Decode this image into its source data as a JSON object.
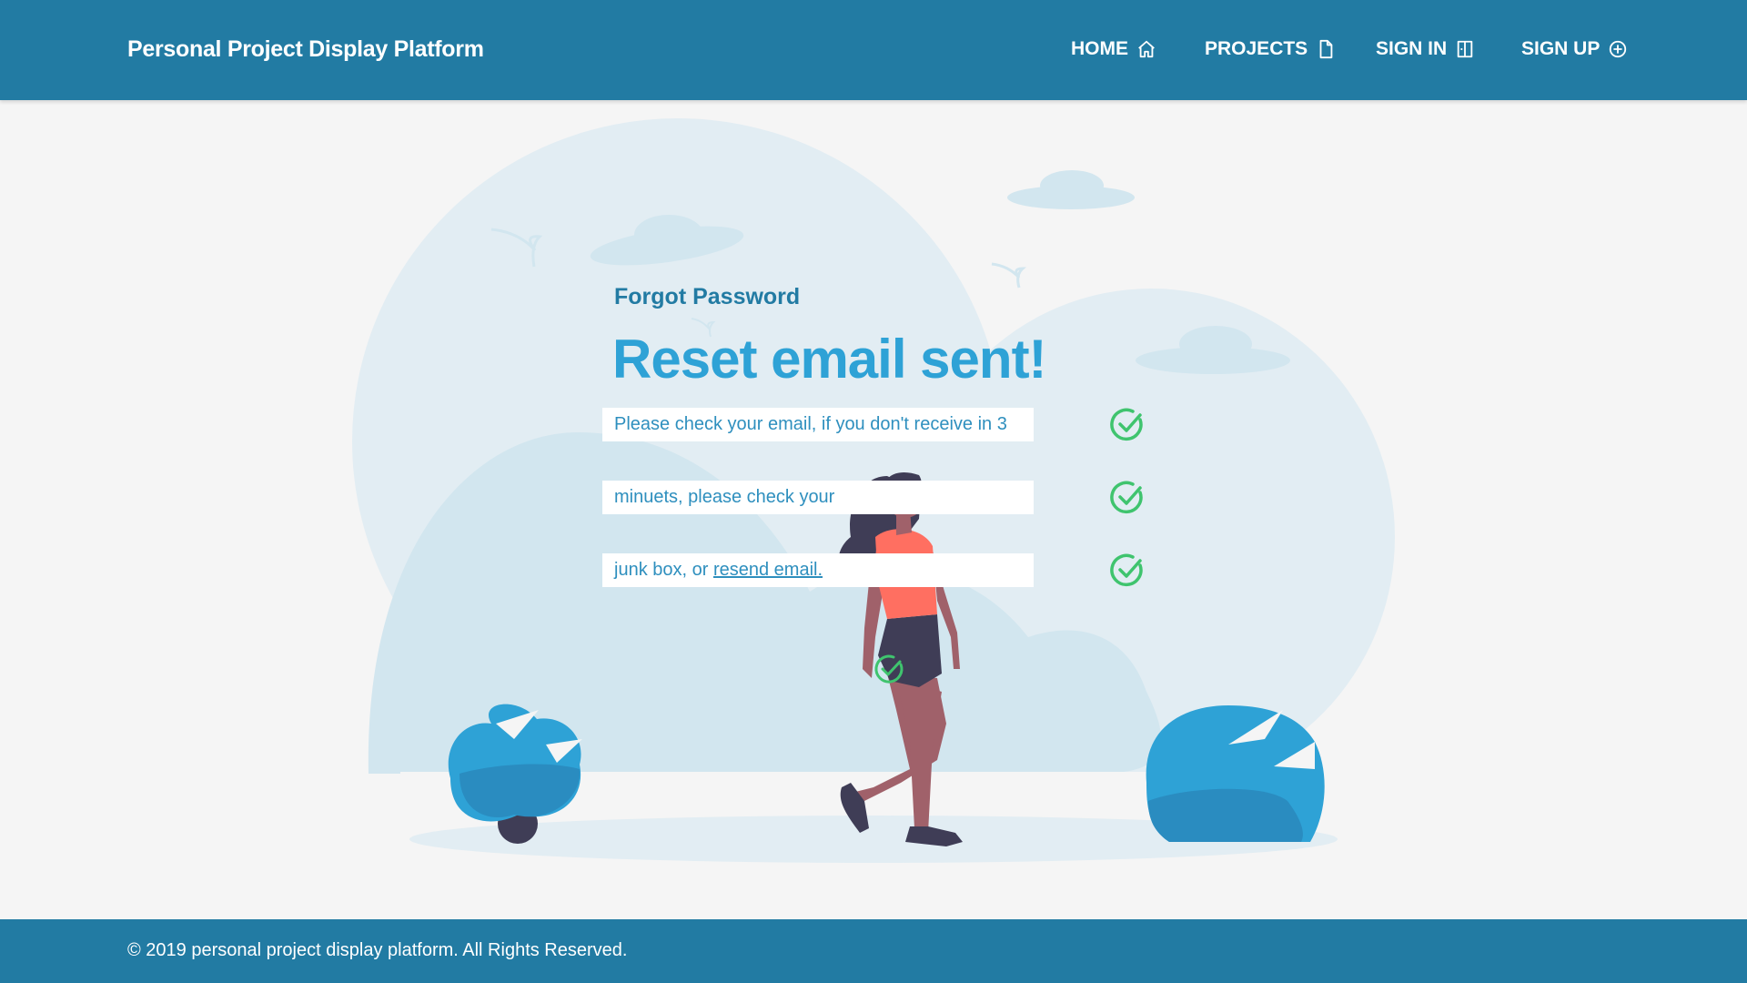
{
  "header": {
    "brand": "Personal Project Display Platform",
    "nav": [
      {
        "label": "HOME",
        "icon": "home-icon"
      },
      {
        "label": "PROJECTS",
        "icon": "file-icon"
      },
      {
        "label": "SIGN IN",
        "icon": "sign-in-icon"
      },
      {
        "label": "SIGN UP",
        "icon": "plus-circle-icon"
      }
    ]
  },
  "main": {
    "kicker": "Forgot Password",
    "headline": "Reset email sent!",
    "lines": [
      {
        "text": "Please check your email, if you don't receive in 3"
      },
      {
        "text": "minuets, please check your"
      },
      {
        "text": "junk box, or ",
        "link": "resend email."
      }
    ],
    "check_icon": "check-circle-icon"
  },
  "footer": {
    "copyright": "© 2019 personal project display platform. All Rights Reserved."
  },
  "colors": {
    "header_bg": "#227ba3",
    "accent": "#2ea2d6",
    "success": "#3fc46e",
    "page_bg": "#f5f5f5"
  }
}
